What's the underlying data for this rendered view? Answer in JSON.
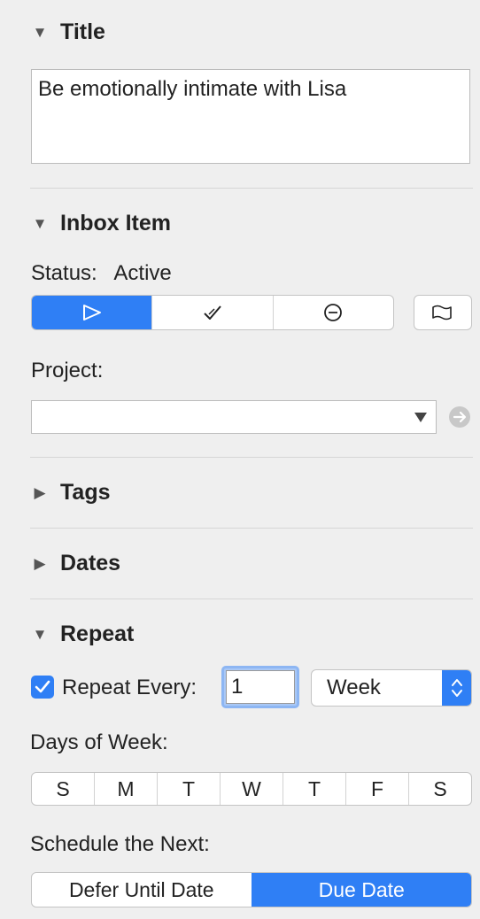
{
  "title_section": {
    "header": "Title",
    "value": "Be emotionally intimate with Lisa"
  },
  "inbox_section": {
    "header": "Inbox Item",
    "status_label": "Status:",
    "status_value": "Active",
    "status_options": [
      "active-icon",
      "completed-icon",
      "dropped-icon"
    ],
    "selected_status": 0,
    "project_label": "Project:",
    "project_value": ""
  },
  "tags_section": {
    "header": "Tags"
  },
  "dates_section": {
    "header": "Dates"
  },
  "repeat_section": {
    "header": "Repeat",
    "repeat_checked": true,
    "repeat_every_label": "Repeat Every:",
    "repeat_every_value": "1",
    "unit_value": "Week",
    "days_label": "Days of Week:",
    "days": [
      "S",
      "M",
      "T",
      "W",
      "T",
      "F",
      "S"
    ],
    "schedule_label": "Schedule the Next:",
    "schedule_options": [
      "Defer Until Date",
      "Due Date"
    ],
    "schedule_selected": 1
  },
  "colors": {
    "accent": "#2f7ff5",
    "background": "#efefef"
  }
}
